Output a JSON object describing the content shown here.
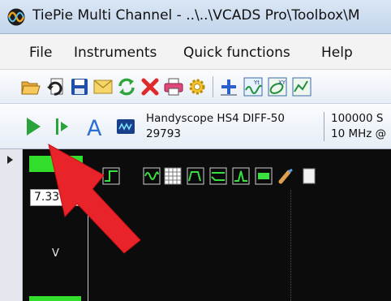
{
  "window": {
    "title": "TiePie Multi Channel - ..\\..\\VCADS Pro\\Toolbox\\M"
  },
  "menu": {
    "items": [
      "File",
      "Instruments",
      "Quick functions",
      "Help"
    ]
  },
  "instrument": {
    "device_name": "Handyscope HS4 DIFF-50",
    "device_serial": "29793",
    "rate_line1": "100000 S",
    "rate_line2": "10 MHz @"
  },
  "scope": {
    "value_readout": "7.33 3",
    "unit_label": "V"
  },
  "colors": {
    "accent_green": "#33dd2b",
    "annotation_red": "#e8242a"
  }
}
